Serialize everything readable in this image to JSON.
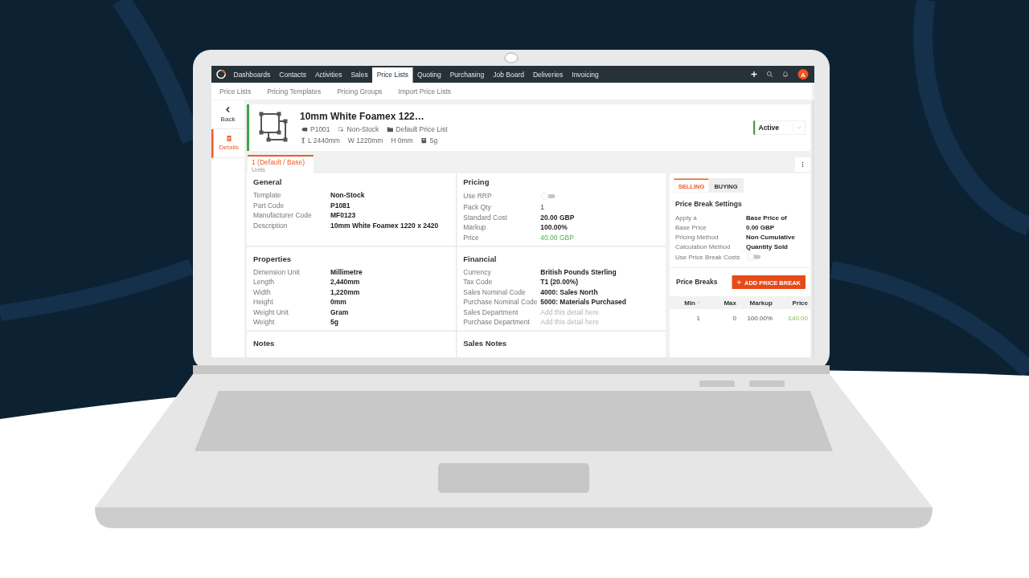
{
  "nav": {
    "items": [
      {
        "label": "Dashboards",
        "selected": false
      },
      {
        "label": "Contacts",
        "selected": false
      },
      {
        "label": "Activities",
        "selected": false
      },
      {
        "label": "Sales",
        "selected": false
      },
      {
        "label": "Price Lists",
        "selected": true
      },
      {
        "label": "Quoting",
        "selected": false
      },
      {
        "label": "Purchasing",
        "selected": false
      },
      {
        "label": "Job Board",
        "selected": false
      },
      {
        "label": "Deliveries",
        "selected": false
      },
      {
        "label": "Invoicing",
        "selected": false
      }
    ],
    "avatar": "A"
  },
  "subnav": {
    "items": [
      {
        "label": "Price Lists"
      },
      {
        "label": "Pricing Templates"
      },
      {
        "label": "Pricing Groups"
      },
      {
        "label": "Import Price Lists"
      }
    ]
  },
  "sidebar": {
    "items": [
      {
        "label": "Back",
        "kind": "back",
        "selected": false
      },
      {
        "label": "Details",
        "kind": "details",
        "selected": true
      }
    ]
  },
  "product": {
    "title": "10mm White Foamex 122…",
    "meta_lines": [
      [
        {
          "kind": "tag",
          "text": "P1001"
        },
        {
          "kind": "stock",
          "text": "Non-Stock"
        },
        {
          "kind": "folder",
          "text": "Default Price List"
        }
      ],
      [
        {
          "kind": "ruler",
          "text": "L 2440mm"
        },
        {
          "kind": "plain",
          "text": "W 1220mm"
        },
        {
          "kind": "plain",
          "text": "H 0mm"
        },
        {
          "kind": "weight",
          "text": "5g"
        }
      ]
    ],
    "status": "Active"
  },
  "unit_tabs": [
    {
      "label": "1 (Default / Base)",
      "sublabel": "Units",
      "selected": true
    }
  ],
  "sections": [
    {
      "title": "General",
      "rows": [
        {
          "label": "Template",
          "value": "Non-Stock",
          "kind": "text"
        },
        {
          "label": "Part Code",
          "value": "P1081",
          "kind": "text"
        },
        {
          "label": "Manufacturer Code",
          "value": "MF0123",
          "kind": "text"
        },
        {
          "label": "Description",
          "value": "10mm White Foamex 1220 x 2420",
          "kind": "text"
        }
      ]
    },
    {
      "title": "Pricing",
      "rows": [
        {
          "label": "Use RRP",
          "kind": "toggle",
          "on": false
        },
        {
          "label": "Pack Qty",
          "value": "1",
          "kind": "plain"
        },
        {
          "label": "Standard Cost",
          "value": "20.00 GBP",
          "kind": "text"
        },
        {
          "label": "Markup",
          "value": "100.00%",
          "kind": "text"
        },
        {
          "label": "Price",
          "value": "40.00 GBP",
          "kind": "price"
        }
      ]
    },
    {
      "title": "Properties",
      "rows": [
        {
          "label": "Dimension Unit",
          "value": "Millimetre",
          "kind": "text"
        },
        {
          "label": "Length",
          "value": "2,440mm",
          "kind": "text"
        },
        {
          "label": "Width",
          "value": "1,220mm",
          "kind": "text"
        },
        {
          "label": "Height",
          "value": "0mm",
          "kind": "text"
        },
        {
          "label": "Weight Unit",
          "value": "Gram",
          "kind": "text"
        },
        {
          "label": "Weight",
          "value": "5g",
          "kind": "text"
        }
      ]
    },
    {
      "title": "Financial",
      "rows": [
        {
          "label": "Currency",
          "value": "British Pounds Sterling",
          "kind": "text"
        },
        {
          "label": "Tax Code",
          "value": "T1 (20.00%)",
          "kind": "text"
        },
        {
          "label": "Sales Nominal Code",
          "value": "4000: Sales North",
          "kind": "text"
        },
        {
          "label": "Purchase Nominal Code",
          "value": "5000: Materials Purchased",
          "kind": "text"
        },
        {
          "label": "Sales Department",
          "placeholder": "Add this detail here",
          "kind": "field"
        },
        {
          "label": "Purchase Department",
          "placeholder": "Add this detail here",
          "kind": "field"
        }
      ]
    },
    {
      "title": "Notes"
    },
    {
      "title": "Sales Notes"
    }
  ],
  "price_break_panel": {
    "tabs": [
      {
        "label": "SELLING",
        "selected": true
      },
      {
        "label": "BUYING",
        "selected": false
      }
    ],
    "settings_title": "Price Break Settings",
    "settings": [
      {
        "label": "Apply a",
        "value": "Base Price of",
        "kind": "text"
      },
      {
        "label": "Base Price",
        "value": "0.00 GBP",
        "kind": "text"
      },
      {
        "label": "Pricing Method",
        "value": "Non Cumulative",
        "kind": "text"
      },
      {
        "label": "Calculation Method",
        "value": "Quantity Sold",
        "kind": "text"
      },
      {
        "label": "Use Price Break Costs",
        "kind": "toggle",
        "on": false
      }
    ],
    "breaks_title": "Price Breaks",
    "add_button": "ADD PRICE BREAK",
    "table": {
      "columns": [
        {
          "label": "Min",
          "sorted": true,
          "kind": "number"
        },
        {
          "label": "Max",
          "sorted": false,
          "kind": "number"
        },
        {
          "label": "Markup",
          "sorted": false,
          "kind": "number"
        },
        {
          "label": "Price",
          "sorted": false,
          "kind": "price"
        }
      ],
      "rows": [
        [
          "1",
          "0",
          "100.00%",
          "£40.00"
        ]
      ]
    }
  }
}
